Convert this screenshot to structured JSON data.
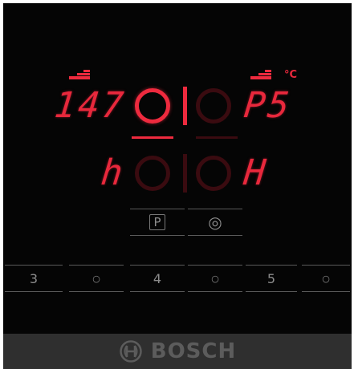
{
  "display": {
    "temperature_value": "147",
    "temperature_unit": "°C",
    "top_right_code": "P5",
    "left_residual_indicator": "h",
    "right_residual_indicator": "H"
  },
  "controls": {
    "top_buttons": [
      {
        "label": "P"
      },
      {
        "label": "◎"
      }
    ],
    "bottom_buttons": [
      {
        "label": "3"
      },
      {
        "label": "○"
      },
      {
        "label": "4"
      },
      {
        "label": "○"
      },
      {
        "label": "5"
      },
      {
        "label": "○"
      }
    ]
  },
  "footer": {
    "brand": "BOSCH"
  },
  "colors": {
    "display_red": "#ee2a3e",
    "dim_red": "#3a0b10",
    "panel_bg": "#050505",
    "footer_bg": "#2f2f2f"
  }
}
